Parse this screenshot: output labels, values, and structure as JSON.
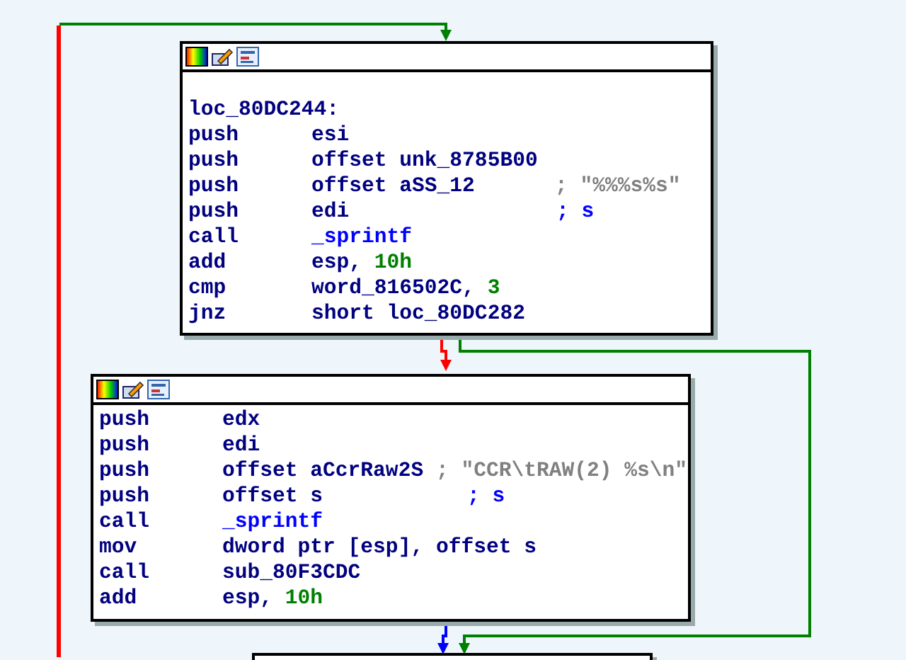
{
  "blocks": [
    {
      "label": "loc_80DC244:",
      "lines": [
        {
          "mnemonic": "push",
          "operands": [
            {
              "kind": "plain",
              "text": "esi"
            }
          ]
        },
        {
          "mnemonic": "push",
          "operands": [
            {
              "kind": "plain",
              "text": "offset unk_8785B00"
            }
          ]
        },
        {
          "mnemonic": "push",
          "operands": [
            {
              "kind": "plain",
              "text": "offset aSS_12"
            }
          ],
          "comment": {
            "kind": "string",
            "text": "; \"%%%s%s\""
          }
        },
        {
          "mnemonic": "push",
          "operands": [
            {
              "kind": "plain",
              "text": "edi"
            }
          ],
          "comment": {
            "kind": "xref",
            "text": "; s"
          }
        },
        {
          "mnemonic": "call",
          "operands": [
            {
              "kind": "func",
              "text": "_sprintf"
            }
          ]
        },
        {
          "mnemonic": "add",
          "operands": [
            {
              "kind": "plain",
              "text": "esp, "
            },
            {
              "kind": "num",
              "text": "10h"
            }
          ]
        },
        {
          "mnemonic": "cmp",
          "operands": [
            {
              "kind": "plain",
              "text": "word_816502C, "
            },
            {
              "kind": "num",
              "text": "3"
            }
          ]
        },
        {
          "mnemonic": "jnz",
          "operands": [
            {
              "kind": "plain",
              "text": "short loc_80DC282"
            }
          ]
        }
      ]
    },
    {
      "lines": [
        {
          "mnemonic": "push",
          "operands": [
            {
              "kind": "plain",
              "text": "edx"
            }
          ]
        },
        {
          "mnemonic": "push",
          "operands": [
            {
              "kind": "plain",
              "text": "edi"
            }
          ]
        },
        {
          "mnemonic": "push",
          "operands": [
            {
              "kind": "plain",
              "text": "offset aCcrRaw2S "
            }
          ],
          "comment": {
            "kind": "string",
            "text": "; \"CCR\\tRAW(2) %s\\n\""
          }
        },
        {
          "mnemonic": "push",
          "operands": [
            {
              "kind": "plain",
              "text": "offset s"
            }
          ],
          "comment": {
            "kind": "xref",
            "text": "; s"
          }
        },
        {
          "mnemonic": "call",
          "operands": [
            {
              "kind": "func",
              "text": "_sprintf"
            }
          ]
        },
        {
          "mnemonic": "mov",
          "operands": [
            {
              "kind": "plain",
              "text": "dword ptr [esp], offset s"
            }
          ]
        },
        {
          "mnemonic": "call",
          "operands": [
            {
              "kind": "plain",
              "text": "sub_80F3CDC"
            }
          ]
        },
        {
          "mnemonic": "add",
          "operands": [
            {
              "kind": "plain",
              "text": "esp, "
            },
            {
              "kind": "num",
              "text": "10h"
            }
          ]
        }
      ]
    }
  ],
  "edges": [
    {
      "color": "#ff0000"
    },
    {
      "color": "#008000"
    },
    {
      "color": "#ff0000"
    },
    {
      "color": "#008000"
    },
    {
      "color": "#0000ff"
    }
  ]
}
